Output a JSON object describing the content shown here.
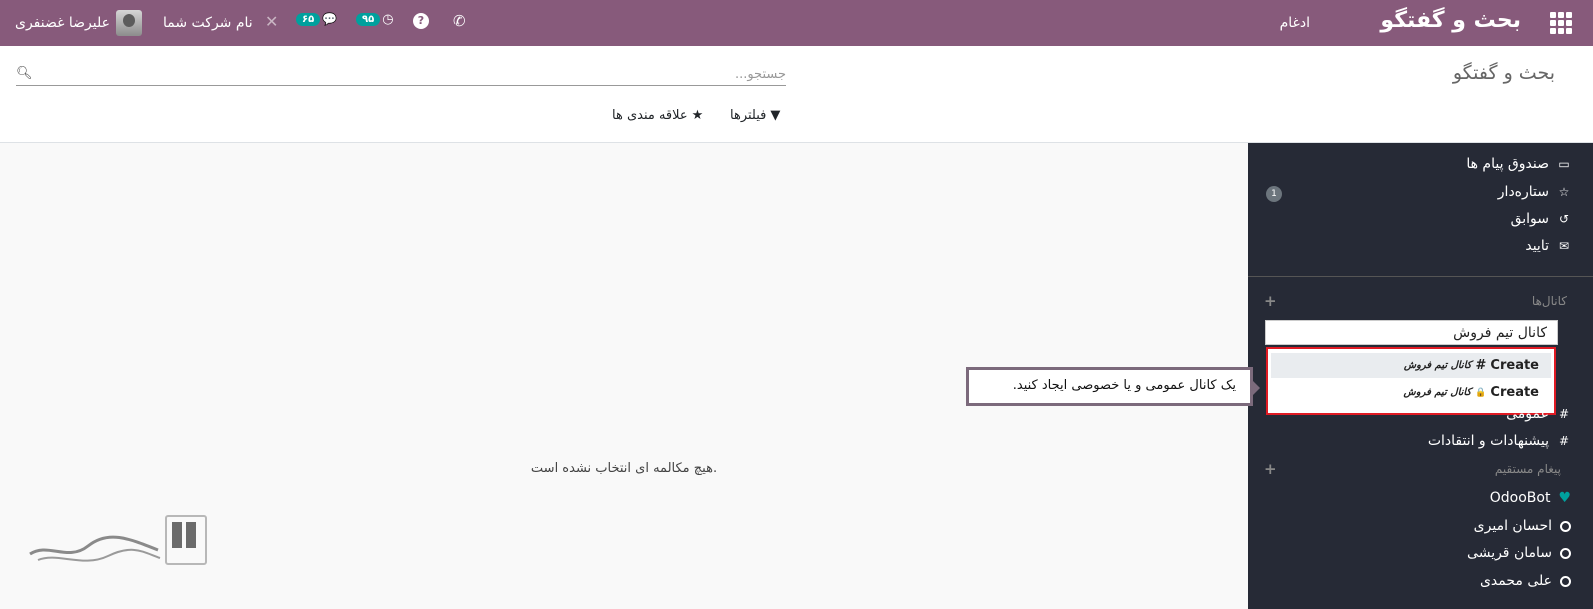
{
  "navbar": {
    "brand": "بحث و گفتگو",
    "merge_menu": "ادغام",
    "user_name": "علیرضا غضنفری",
    "company": "نام شرکت شما",
    "messages_badge": "۶۵",
    "activities_badge": "۹۵",
    "help_label": "?",
    "accent": "#875a7b"
  },
  "control": {
    "title": "بحث و گفتگو",
    "search_placeholder": "جستجو...",
    "filters_label": "فیلترها",
    "favorites_label": "علاقه مندی ها"
  },
  "main": {
    "empty_text": "هیچ مکالمه ای انتخاب نشده است."
  },
  "sidebar": {
    "mailboxes": [
      {
        "label": "صندوق پیام ها",
        "icon": "inbox-icon"
      },
      {
        "label": "ستاره‌دار",
        "icon": "star-icon",
        "counter": "1"
      },
      {
        "label": "سوابق",
        "icon": "history-icon"
      },
      {
        "label": "تایید",
        "icon": "envelope-icon"
      }
    ],
    "channels_title": "کانال‌ها",
    "channel_input_value": "کانال تیم فروش",
    "autocomplete": [
      {
        "action": "Create",
        "prefix": "#",
        "name": "کانال تیم فروش"
      },
      {
        "action": "Create",
        "prefix": "🔒",
        "name": "کانال تیم فروش"
      }
    ],
    "channels": [
      {
        "label": "عمومی"
      },
      {
        "label": "پیشنهادات و انتقادات"
      }
    ],
    "dm_title": "پیغام مستقیم",
    "direct_messages": [
      {
        "label": "OdooBot",
        "icon": "heart-icon"
      },
      {
        "label": "احسان امیری",
        "icon": "status-circle-icon"
      },
      {
        "label": "سامان قریشی",
        "icon": "status-circle-icon"
      },
      {
        "label": "علی محمدی",
        "icon": "status-circle-icon"
      }
    ]
  },
  "tooltip": {
    "text": "یک کانال عمومی و یا خصوصی ایجاد کنید."
  }
}
